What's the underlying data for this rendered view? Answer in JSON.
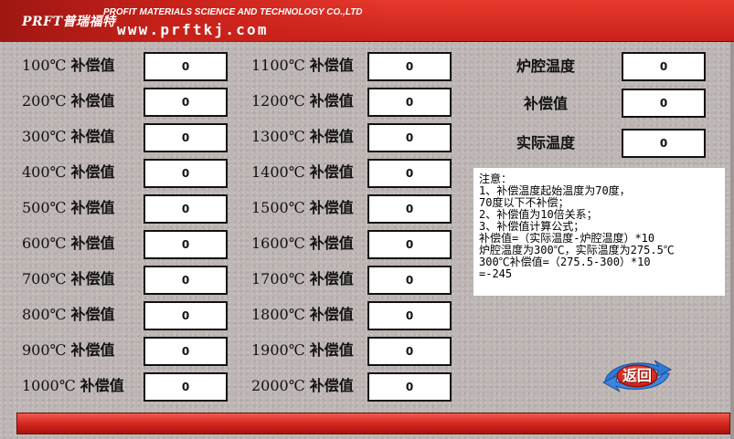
{
  "header": {
    "logo_text": "PRFT普瑞福特",
    "company_name": "PROFIT MATERIALS SCIENCE AND TECHNOLOGY CO.,LTD",
    "website": "www.prftkj.com"
  },
  "left_rows": [
    {
      "temp": "100℃",
      "label": "补偿值",
      "value": "0"
    },
    {
      "temp": "200℃",
      "label": "补偿值",
      "value": "0"
    },
    {
      "temp": "300℃",
      "label": "补偿值",
      "value": "0"
    },
    {
      "temp": "400℃",
      "label": "补偿值",
      "value": "0"
    },
    {
      "temp": "500℃",
      "label": "补偿值",
      "value": "0"
    },
    {
      "temp": "600℃",
      "label": "补偿值",
      "value": "0"
    },
    {
      "temp": "700℃",
      "label": "补偿值",
      "value": "0"
    },
    {
      "temp": "800℃",
      "label": "补偿值",
      "value": "0"
    },
    {
      "temp": "900℃",
      "label": "补偿值",
      "value": "0"
    },
    {
      "temp": "1000℃",
      "label": "补偿值",
      "value": "0"
    }
  ],
  "middle_rows": [
    {
      "temp": "1100℃",
      "label": "补偿值",
      "value": "0"
    },
    {
      "temp": "1200℃",
      "label": "补偿值",
      "value": "0"
    },
    {
      "temp": "1300℃",
      "label": "补偿值",
      "value": "0"
    },
    {
      "temp": "1400℃",
      "label": "补偿值",
      "value": "0"
    },
    {
      "temp": "1500℃",
      "label": "补偿值",
      "value": "0"
    },
    {
      "temp": "1600℃",
      "label": "补偿值",
      "value": "0"
    },
    {
      "temp": "1700℃",
      "label": "补偿值",
      "value": "0"
    },
    {
      "temp": "1800℃",
      "label": "补偿值",
      "value": "0"
    },
    {
      "temp": "1900℃",
      "label": "补偿值",
      "value": "0"
    },
    {
      "temp": "2000℃",
      "label": "补偿值",
      "value": "0"
    }
  ],
  "readouts": [
    {
      "label": "炉腔温度",
      "value": "0"
    },
    {
      "label": "补偿值",
      "value": "0"
    },
    {
      "label": "实际温度",
      "value": "0"
    }
  ],
  "notes": {
    "lines": [
      "注意：",
      "1、补偿温度起始温度为70度，",
      "    70度以下不补偿；",
      "2、补偿值为10倍关系；",
      "3、补偿值计算公式；",
      "补偿值=（实际温度-炉腔温度）*10",
      "炉腔温度为300℃，实际温度为275.5℃",
      "300℃补偿值=（275.5-300）*10",
      "              =-245"
    ]
  },
  "back_button": {
    "label": "返回"
  },
  "colors": {
    "header_red": "#d0241b",
    "background": "#bdb5b3"
  }
}
